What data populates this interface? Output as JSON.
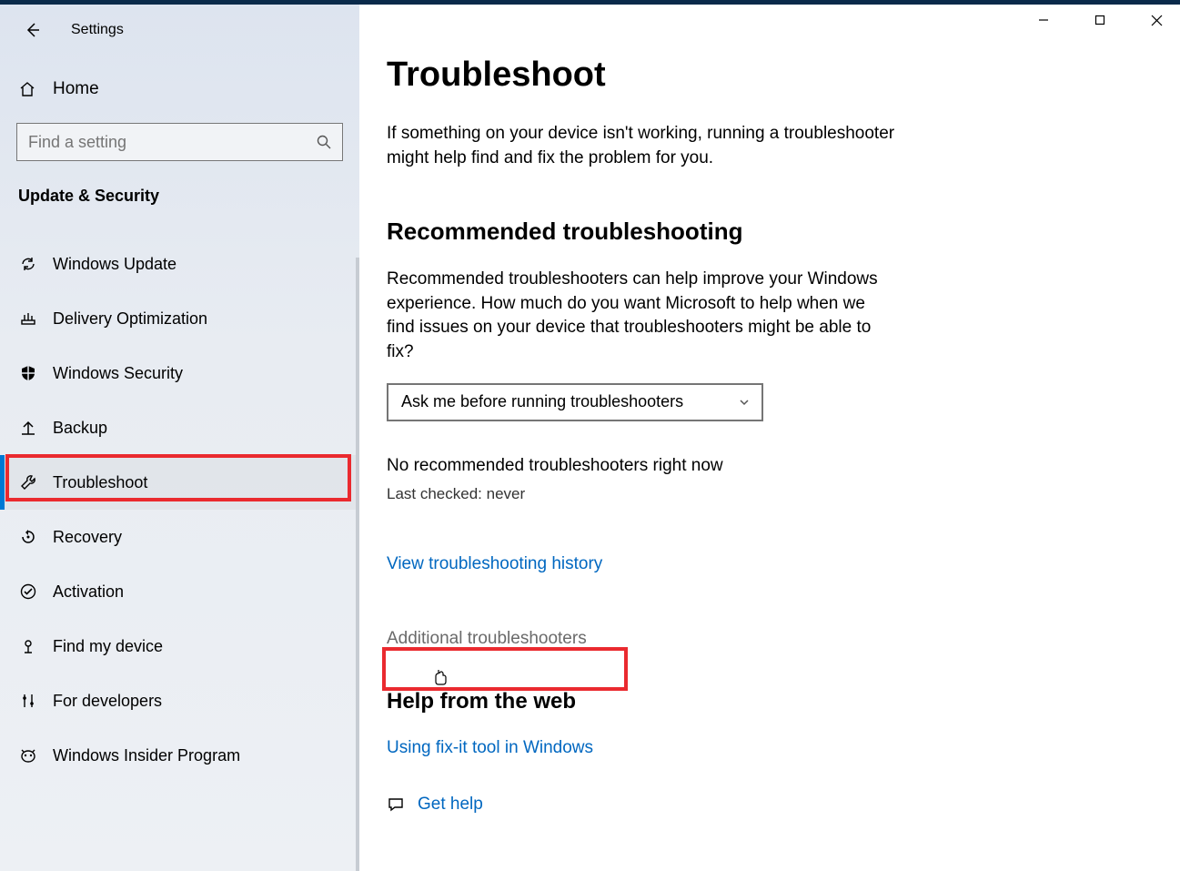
{
  "app_title": "Settings",
  "home_label": "Home",
  "search_placeholder": "Find a setting",
  "category": "Update & Security",
  "nav": [
    {
      "id": "windows-update",
      "label": "Windows Update"
    },
    {
      "id": "delivery-optimization",
      "label": "Delivery Optimization"
    },
    {
      "id": "windows-security",
      "label": "Windows Security"
    },
    {
      "id": "backup",
      "label": "Backup"
    },
    {
      "id": "troubleshoot",
      "label": "Troubleshoot",
      "active": true
    },
    {
      "id": "recovery",
      "label": "Recovery"
    },
    {
      "id": "activation",
      "label": "Activation"
    },
    {
      "id": "find-my-device",
      "label": "Find my device"
    },
    {
      "id": "for-developers",
      "label": "For developers"
    },
    {
      "id": "windows-insider",
      "label": "Windows Insider Program"
    }
  ],
  "page": {
    "title": "Troubleshoot",
    "intro": "If something on your device isn't working, running a troubleshooter might help find and fix the problem for you.",
    "rec_title": "Recommended troubleshooting",
    "rec_text": "Recommended troubleshooters can help improve your Windows experience. How much do you want Microsoft to help when we find issues on your device that troubleshooters might be able to fix?",
    "dropdown_value": "Ask me before running troubleshooters",
    "status_line": "No recommended troubleshooters right now",
    "last_checked": "Last checked: never",
    "history_link": "View troubleshooting history",
    "additional_link": "Additional troubleshooters",
    "help_title": "Help from the web",
    "help_link": "Using fix-it tool in Windows",
    "get_help": "Get help"
  }
}
